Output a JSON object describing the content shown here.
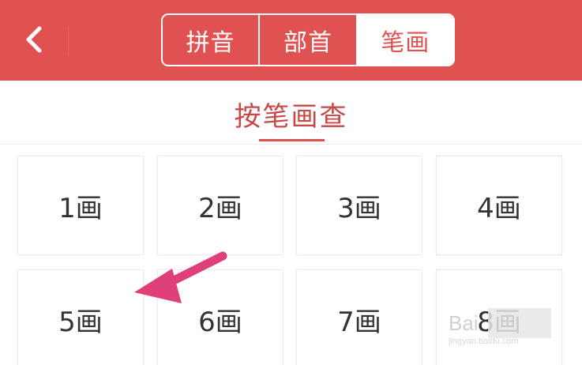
{
  "header": {
    "tabs": [
      {
        "label": "拼音",
        "active": false
      },
      {
        "label": "部首",
        "active": false
      },
      {
        "label": "笔画",
        "active": true
      }
    ],
    "bg_color": "#e05252"
  },
  "subheader": {
    "title": "按笔画查"
  },
  "stroke_grid": {
    "items": [
      "1画",
      "2画",
      "3画",
      "4画",
      "5画",
      "6画",
      "7画",
      "8画"
    ]
  },
  "annotation": {
    "type": "arrow",
    "color": "#e0407a",
    "points_to": "5画"
  },
  "watermark": {
    "text": "Bai",
    "subtext": "jingyan.baidu.com"
  },
  "icons": {
    "back": "chevron-left-icon"
  }
}
